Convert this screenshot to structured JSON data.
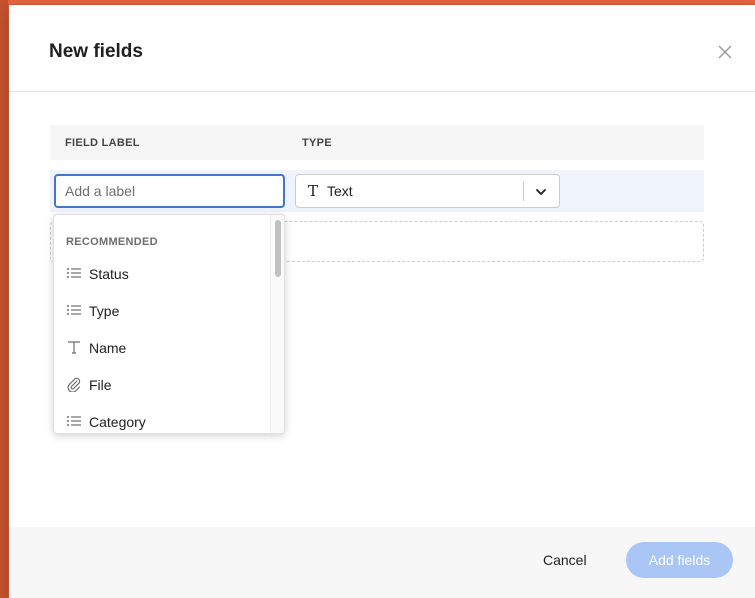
{
  "modal": {
    "title": "New fields"
  },
  "table": {
    "col_label": "FIELD LABEL",
    "col_type": "TYPE"
  },
  "row": {
    "label_placeholder": "Add a label",
    "label_value": "",
    "type_icon": "T",
    "type_value": "Text"
  },
  "dropdown": {
    "section": "RECOMMENDED",
    "items": [
      {
        "icon": "list-icon",
        "label": "Status"
      },
      {
        "icon": "list-icon",
        "label": "Type"
      },
      {
        "icon": "text-type-icon",
        "label": "Name"
      },
      {
        "icon": "paperclip-icon",
        "label": "File"
      },
      {
        "icon": "list-icon",
        "label": "Category"
      }
    ]
  },
  "footer": {
    "cancel_label": "Cancel",
    "add_label": "Add fields"
  },
  "colors": {
    "backdrop": "#e9663f",
    "accent": "#4573d2",
    "primary_disabled": "#a9c6f5",
    "row_highlight": "#eef3fc"
  }
}
